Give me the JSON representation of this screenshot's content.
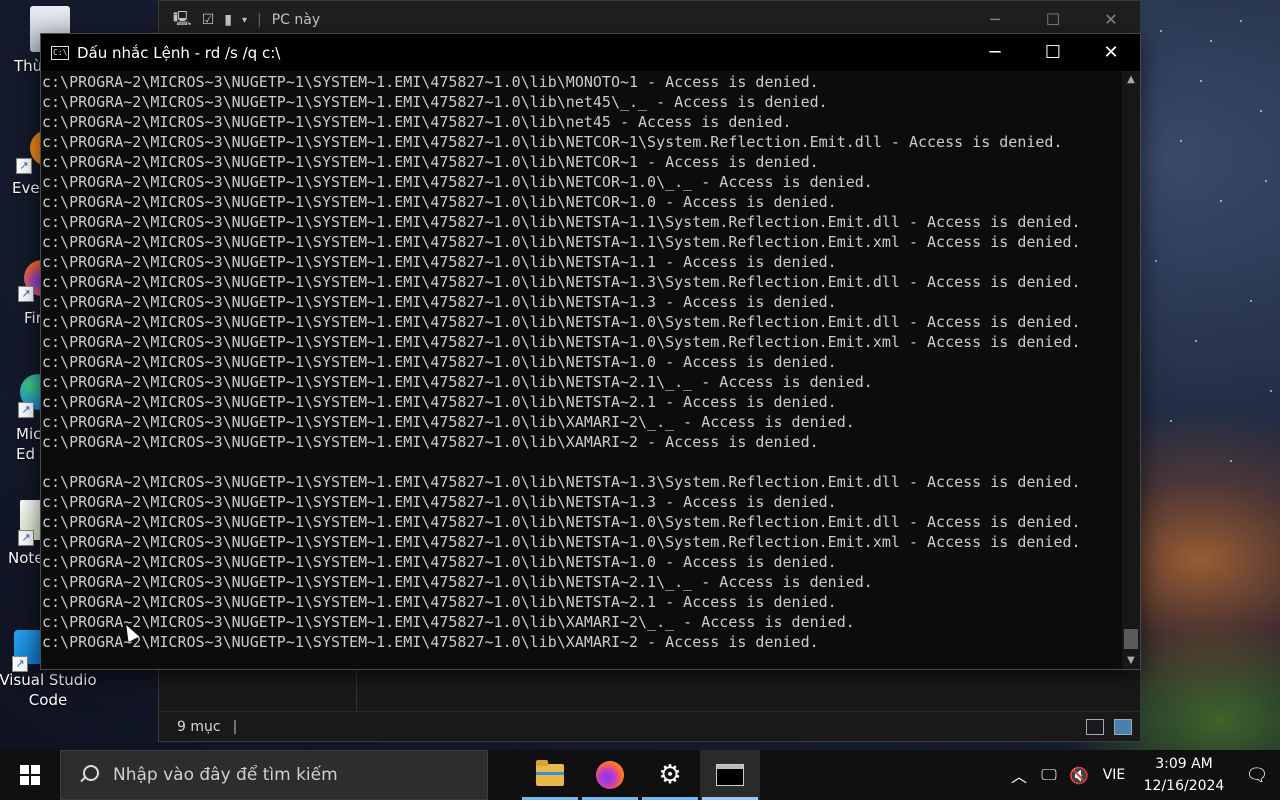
{
  "desktop": {
    "icons": [
      {
        "label": "Thùc",
        "icon": "recycle-bin-icon"
      },
      {
        "label": "Everc",
        "icon": "everything-icon"
      },
      {
        "label": "Fir",
        "icon": "firefox-icon"
      },
      {
        "label": "Mic\nEd",
        "icon": "edge-icon"
      },
      {
        "label": "Note",
        "icon": "notepadpp-icon"
      },
      {
        "label": "Visual Studio\nCode",
        "icon": "vscode-icon"
      }
    ]
  },
  "explorer": {
    "title": "PC này",
    "status_text": "9 mục",
    "status_sep": "|"
  },
  "cmd": {
    "title": "Dấu nhắc Lệnh - rd  /s /q c:\\",
    "lines": [
      "c:\\PROGRA~2\\MICROS~3\\NUGETP~1\\SYSTEM~1.EMI\\475827~1.0\\lib\\MONOTO~1 - Access is denied.",
      "c:\\PROGRA~2\\MICROS~3\\NUGETP~1\\SYSTEM~1.EMI\\475827~1.0\\lib\\net45\\_._ - Access is denied.",
      "c:\\PROGRA~2\\MICROS~3\\NUGETP~1\\SYSTEM~1.EMI\\475827~1.0\\lib\\net45 - Access is denied.",
      "c:\\PROGRA~2\\MICROS~3\\NUGETP~1\\SYSTEM~1.EMI\\475827~1.0\\lib\\NETCOR~1\\System.Reflection.Emit.dll - Access is denied.",
      "c:\\PROGRA~2\\MICROS~3\\NUGETP~1\\SYSTEM~1.EMI\\475827~1.0\\lib\\NETCOR~1 - Access is denied.",
      "c:\\PROGRA~2\\MICROS~3\\NUGETP~1\\SYSTEM~1.EMI\\475827~1.0\\lib\\NETCOR~1.0\\_._ - Access is denied.",
      "c:\\PROGRA~2\\MICROS~3\\NUGETP~1\\SYSTEM~1.EMI\\475827~1.0\\lib\\NETCOR~1.0 - Access is denied.",
      "c:\\PROGRA~2\\MICROS~3\\NUGETP~1\\SYSTEM~1.EMI\\475827~1.0\\lib\\NETSTA~1.1\\System.Reflection.Emit.dll - Access is denied.",
      "c:\\PROGRA~2\\MICROS~3\\NUGETP~1\\SYSTEM~1.EMI\\475827~1.0\\lib\\NETSTA~1.1\\System.Reflection.Emit.xml - Access is denied.",
      "c:\\PROGRA~2\\MICROS~3\\NUGETP~1\\SYSTEM~1.EMI\\475827~1.0\\lib\\NETSTA~1.1 - Access is denied.",
      "c:\\PROGRA~2\\MICROS~3\\NUGETP~1\\SYSTEM~1.EMI\\475827~1.0\\lib\\NETSTA~1.3\\System.Reflection.Emit.dll - Access is denied.",
      "c:\\PROGRA~2\\MICROS~3\\NUGETP~1\\SYSTEM~1.EMI\\475827~1.0\\lib\\NETSTA~1.3 - Access is denied.",
      "c:\\PROGRA~2\\MICROS~3\\NUGETP~1\\SYSTEM~1.EMI\\475827~1.0\\lib\\NETSTA~1.0\\System.Reflection.Emit.dll - Access is denied.",
      "c:\\PROGRA~2\\MICROS~3\\NUGETP~1\\SYSTEM~1.EMI\\475827~1.0\\lib\\NETSTA~1.0\\System.Reflection.Emit.xml - Access is denied.",
      "c:\\PROGRA~2\\MICROS~3\\NUGETP~1\\SYSTEM~1.EMI\\475827~1.0\\lib\\NETSTA~1.0 - Access is denied.",
      "c:\\PROGRA~2\\MICROS~3\\NUGETP~1\\SYSTEM~1.EMI\\475827~1.0\\lib\\NETSTA~2.1\\_._ - Access is denied.",
      "c:\\PROGRA~2\\MICROS~3\\NUGETP~1\\SYSTEM~1.EMI\\475827~1.0\\lib\\NETSTA~2.1 - Access is denied.",
      "c:\\PROGRA~2\\MICROS~3\\NUGETP~1\\SYSTEM~1.EMI\\475827~1.0\\lib\\XAMARI~2\\_._ - Access is denied.",
      "c:\\PROGRA~2\\MICROS~3\\NUGETP~1\\SYSTEM~1.EMI\\475827~1.0\\lib\\XAMARI~2 - Access is denied.",
      "",
      "c:\\PROGRA~2\\MICROS~3\\NUGETP~1\\SYSTEM~1.EMI\\475827~1.0\\lib\\NETSTA~1.3\\System.Reflection.Emit.dll - Access is denied.",
      "c:\\PROGRA~2\\MICROS~3\\NUGETP~1\\SYSTEM~1.EMI\\475827~1.0\\lib\\NETSTA~1.3 - Access is denied.",
      "c:\\PROGRA~2\\MICROS~3\\NUGETP~1\\SYSTEM~1.EMI\\475827~1.0\\lib\\NETSTA~1.0\\System.Reflection.Emit.dll - Access is denied.",
      "c:\\PROGRA~2\\MICROS~3\\NUGETP~1\\SYSTEM~1.EMI\\475827~1.0\\lib\\NETSTA~1.0\\System.Reflection.Emit.xml - Access is denied.",
      "c:\\PROGRA~2\\MICROS~3\\NUGETP~1\\SYSTEM~1.EMI\\475827~1.0\\lib\\NETSTA~1.0 - Access is denied.",
      "c:\\PROGRA~2\\MICROS~3\\NUGETP~1\\SYSTEM~1.EMI\\475827~1.0\\lib\\NETSTA~2.1\\_._ - Access is denied.",
      "c:\\PROGRA~2\\MICROS~3\\NUGETP~1\\SYSTEM~1.EMI\\475827~1.0\\lib\\NETSTA~2.1 - Access is denied.",
      "c:\\PROGRA~2\\MICROS~3\\NUGETP~1\\SYSTEM~1.EMI\\475827~1.0\\lib\\XAMARI~2\\_._ - Access is denied.",
      "c:\\PROGRA~2\\MICROS~3\\NUGETP~1\\SYSTEM~1.EMI\\475827~1.0\\lib\\XAMARI~2 - Access is denied."
    ]
  },
  "taskbar": {
    "search_placeholder": "Nhập vào đây để tìm kiếm",
    "apps": [
      {
        "name": "file-explorer",
        "icon": "folder-icon"
      },
      {
        "name": "firefox",
        "icon": "firefox-icon"
      },
      {
        "name": "settings",
        "icon": "gear-icon"
      },
      {
        "name": "command-prompt",
        "icon": "terminal-icon",
        "active": true
      }
    ],
    "language": "VIE",
    "time": "3:09 AM",
    "date": "12/16/2024"
  },
  "colors": {
    "console_bg": "#0c0c0c",
    "console_text": "#cccccc",
    "taskbar_bg": "#101010",
    "accent": "#76b9ed"
  }
}
